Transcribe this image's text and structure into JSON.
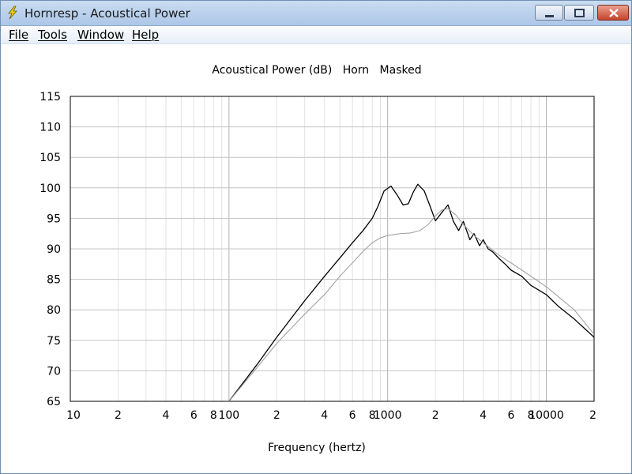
{
  "window": {
    "title": "Hornresp - Acoustical Power",
    "icon": "lightning-bolt-icon"
  },
  "menu": {
    "items": [
      "File",
      "Tools",
      "Window",
      "Help"
    ]
  },
  "chart_data": {
    "type": "line",
    "title": "Acoustical Power (dB)   Horn   Masked",
    "xlabel": "Frequency (hertz)",
    "ylabel": "",
    "xscale": "log",
    "xlim": [
      10,
      20000
    ],
    "ylim": [
      65,
      115
    ],
    "grid": true,
    "x_tick_labels": [
      {
        "x": 10,
        "label": "10"
      },
      {
        "x": 20,
        "label": "2"
      },
      {
        "x": 40,
        "label": "4"
      },
      {
        "x": 60,
        "label": "6"
      },
      {
        "x": 80,
        "label": "8"
      },
      {
        "x": 100,
        "label": "100"
      },
      {
        "x": 200,
        "label": "2"
      },
      {
        "x": 400,
        "label": "4"
      },
      {
        "x": 600,
        "label": "6"
      },
      {
        "x": 800,
        "label": "8"
      },
      {
        "x": 1000,
        "label": "1000"
      },
      {
        "x": 2000,
        "label": "2"
      },
      {
        "x": 4000,
        "label": "4"
      },
      {
        "x": 6000,
        "label": "6"
      },
      {
        "x": 8000,
        "label": "8"
      },
      {
        "x": 10000,
        "label": "10000"
      },
      {
        "x": 20000,
        "label": "2"
      }
    ],
    "y_ticks": [
      65,
      70,
      75,
      80,
      85,
      90,
      95,
      100,
      105,
      110,
      115
    ],
    "series": [
      {
        "color": "#000000",
        "x": [
          100,
          150,
          200,
          300,
          400,
          500,
          600,
          700,
          800,
          870,
          950,
          1050,
          1150,
          1250,
          1350,
          1450,
          1550,
          1700,
          1850,
          2000,
          2200,
          2400,
          2600,
          2800,
          3000,
          3300,
          3500,
          3800,
          4000,
          4300,
          4600,
          5000,
          5500,
          6000,
          7000,
          8000,
          10000,
          12000,
          15000,
          20000
        ],
        "y": [
          65,
          71,
          75.5,
          81.5,
          85.5,
          88.5,
          91,
          93,
          95,
          97,
          99.5,
          100.3,
          98.8,
          97.2,
          97.4,
          99.3,
          100.6,
          99.5,
          97,
          94.6,
          96,
          97.2,
          94.5,
          93,
          94.5,
          91.5,
          92.5,
          90.5,
          91.5,
          90,
          89.5,
          88.5,
          87.5,
          86.5,
          85.5,
          84,
          82.5,
          80.5,
          78.5,
          75.5
        ]
      },
      {
        "color": "#9a9a9a",
        "x": [
          100,
          150,
          200,
          300,
          400,
          500,
          600,
          700,
          800,
          900,
          1000,
          1200,
          1400,
          1600,
          1800,
          2000,
          2200,
          2400,
          2700,
          3000,
          3500,
          4000,
          5000,
          6000,
          8000,
          10000,
          15000,
          20000
        ],
        "y": [
          65,
          70.5,
          74.5,
          79.3,
          82.5,
          85.5,
          87.7,
          89.6,
          91,
          91.8,
          92.2,
          92.5,
          92.6,
          93,
          94,
          95.4,
          96.4,
          96.6,
          95.5,
          94,
          92.2,
          91,
          89,
          87.7,
          85.5,
          83.8,
          80,
          76
        ]
      }
    ]
  }
}
